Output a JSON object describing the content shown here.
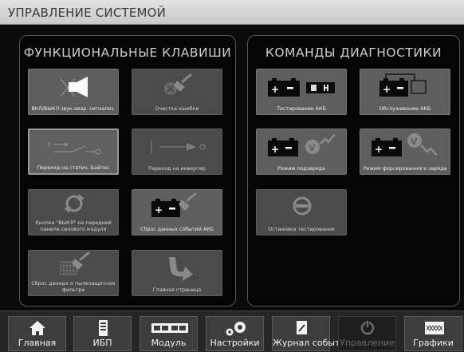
{
  "header": {
    "title": "УПРАВЛЕНИЕ СИСТЕМОЙ"
  },
  "function_keys": {
    "title": "ФУНКЦИОНАЛЬНЫЕ КЛАВИШИ",
    "buttons": [
      {
        "label": "ВКЛ/ВЫКЛ звук.авар. сигнализ.",
        "icon": "speaker-mute-icon"
      },
      {
        "label": "Очистка ошибки",
        "icon": "broom-error-icon"
      },
      {
        "label": "Переход на статич. Байпас",
        "icon": "bypass-switch-icon"
      },
      {
        "label": "Переход на инвертер",
        "icon": "inverter-switch-icon"
      },
      {
        "label": "Кнопка \"ВЫКЛ\" на передней панели силового модуля",
        "icon": "power-cycle-icon"
      },
      {
        "label": "Сброс данных событий АКБ",
        "icon": "battery-broom-icon"
      },
      {
        "label": "Сброс данных о пылезащитном фильтре",
        "icon": "filter-broom-icon"
      },
      {
        "label": "Главная страница",
        "icon": "return-arrow-icon"
      }
    ]
  },
  "diagnostics": {
    "title": "КОМАНДЫ ДИАГНОСТИКИ",
    "buttons": [
      {
        "label": "Тестирование АКБ",
        "icon": "battery-test-icon"
      },
      {
        "label": "Обслуживание АКБ",
        "icon": "battery-maintenance-icon"
      },
      {
        "label": "Режим подзаряда",
        "icon": "battery-float-charge-icon"
      },
      {
        "label": "Режим форсированного заряда",
        "icon": "battery-boost-charge-icon"
      },
      {
        "label": "Остановка тестирования",
        "icon": "stop-test-icon"
      }
    ]
  },
  "nav": [
    {
      "label": "Главная",
      "icon": "home-icon"
    },
    {
      "label": "ИБП",
      "icon": "ups-icon"
    },
    {
      "label": "Модуль",
      "icon": "module-icon"
    },
    {
      "label": "Настройки",
      "icon": "settings-icon"
    },
    {
      "label": "Журнал событий",
      "icon": "event-log-icon"
    },
    {
      "label": "Управление",
      "icon": "control-icon"
    },
    {
      "label": "Графики",
      "icon": "charts-icon"
    }
  ]
}
